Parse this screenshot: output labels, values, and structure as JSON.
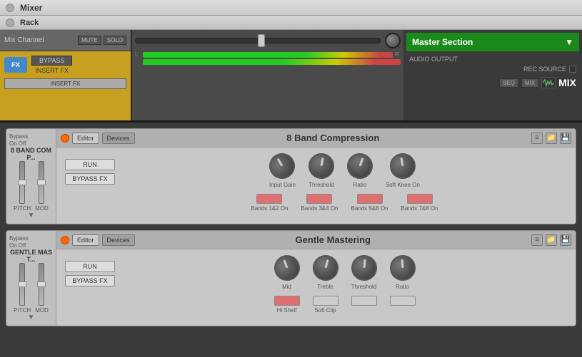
{
  "window": {
    "title": "Mixer",
    "rack_label": "Rack"
  },
  "top_bar": {
    "mix_channel": "Mix Channel",
    "mute": "MUTE",
    "solo": "SOLO",
    "bypass_btn": "BYPASS",
    "insert_fx": "INSERT FX",
    "mix_label": "MIX",
    "seq_btn": "SEQ",
    "mix_btn": "MIX",
    "waveform_icon": "waveform"
  },
  "master_section": {
    "title": "Master Section",
    "dropdown_arrow": "▼",
    "audio_output": "AUDIO OUTPUT",
    "rec_source": "REC SOURCE"
  },
  "level_display": {
    "l": "L",
    "r": "R"
  },
  "fx_strips": [
    {
      "id": "band-compression",
      "bypass_label": "Bypass",
      "on_label": "On",
      "off_label": "Off",
      "name": "8 BAND COMP...",
      "pitch_label": "PITCH",
      "mod_label": "MOD",
      "header_dot_color": "#ff6600",
      "editor_btn": "Editor",
      "devices_btn": "Devices",
      "title": "8 Band Compression",
      "run_btn": "RUN",
      "bypass_fx_btn": "BYPASS FX",
      "knobs": [
        {
          "id": "input-gain",
          "label": "Input Gain",
          "angle": -30
        },
        {
          "id": "threshold",
          "label": "Threshold",
          "angle": 10
        },
        {
          "id": "ratio",
          "label": "Ratio",
          "angle": 20
        },
        {
          "id": "soft-knee-on",
          "label": "Soft Knee On",
          "angle": -10
        }
      ],
      "band_buttons": [
        {
          "id": "bands-12",
          "label": "Bands 1&2 On",
          "on": true
        },
        {
          "id": "bands-34",
          "label": "Bands 3&4 On",
          "on": true
        },
        {
          "id": "bands-56",
          "label": "Bands 5&6 On",
          "on": true
        },
        {
          "id": "bands-78",
          "label": "Bands 7&8 On",
          "on": true
        }
      ],
      "icons": [
        "≡",
        "📁",
        "💾"
      ]
    },
    {
      "id": "gentle-mastering",
      "bypass_label": "Bypass",
      "on_label": "On",
      "off_label": "Off",
      "name": "GENTLE MAST...",
      "pitch_label": "PITCH",
      "mod_label": "MOD",
      "header_dot_color": "#ff6600",
      "editor_btn": "Editor",
      "devices_btn": "Devices",
      "title": "Gentle Mastering",
      "run_btn": "RUN",
      "bypass_fx_btn": "BYPASS FX",
      "knobs": [
        {
          "id": "mid",
          "label": "Mid",
          "angle": -20
        },
        {
          "id": "treble",
          "label": "Treble",
          "angle": 15
        },
        {
          "id": "threshold",
          "label": "Threshold",
          "angle": 5
        },
        {
          "id": "ratio",
          "label": "Ratio",
          "angle": -5
        }
      ],
      "band_buttons": [
        {
          "id": "hi-shelf",
          "label": "Hi Shelf",
          "on": true
        },
        {
          "id": "soft-clip",
          "label": "Soft Clip",
          "on": false
        },
        {
          "id": "extra1",
          "label": "",
          "on": false
        },
        {
          "id": "extra2",
          "label": "",
          "on": false
        }
      ],
      "icons": [
        "≡",
        "📁",
        "💾"
      ]
    }
  ]
}
